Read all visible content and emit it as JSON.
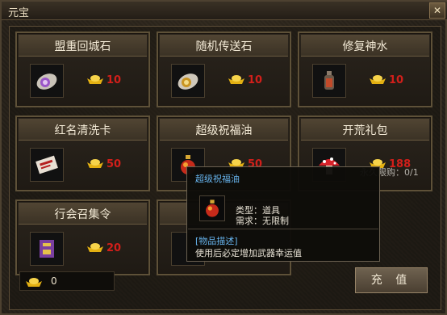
{
  "window": {
    "title": "元宝"
  },
  "shop": {
    "items": [
      {
        "name": "盟重回城石",
        "price": "10",
        "icon": "purple-stone-scroll-icon"
      },
      {
        "name": "随机传送石",
        "price": "10",
        "icon": "gold-stone-scroll-icon"
      },
      {
        "name": "修复神水",
        "price": "10",
        "icon": "potion-bottle-icon"
      },
      {
        "name": "红名清洗卡",
        "price": "50",
        "icon": "red-card-icon"
      },
      {
        "name": "超级祝福油",
        "price": "50",
        "icon": "blessing-oil-icon"
      },
      {
        "name": "开荒礼包",
        "price": "188",
        "icon": "mushroom-gift-icon"
      },
      {
        "name": "行会召集令",
        "price": "20",
        "icon": "guild-token-icon"
      }
    ],
    "limit_text": "永久限购：0/1"
  },
  "footer": {
    "balance": "0",
    "recharge_label": "充 值"
  },
  "tooltip": {
    "title": "超级祝福油",
    "type_line": "类型：道具",
    "req_line": "需求：无限制",
    "desc_header": "[物品描述]",
    "desc_text": "使用后必定增加武器幸运值"
  },
  "colors": {
    "price": "#d21f1a",
    "tooltip_title": "#68b6f0",
    "gold": "#f2c21b"
  }
}
